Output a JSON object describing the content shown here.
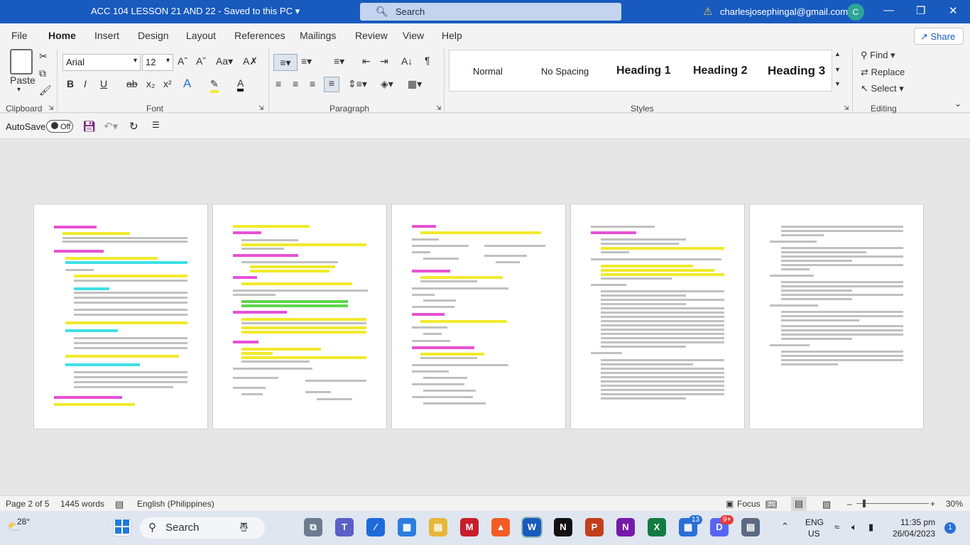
{
  "titlebar": {
    "doc_title": "ACC 104 LESSON 21 AND 22  -  Saved to this PC  ▾",
    "search_placeholder": "Search",
    "email": "charlesjosephingal@gmail.com",
    "avatar_initial": "C",
    "minimize": "—",
    "restore": "❐",
    "close": "✕"
  },
  "menu": {
    "tabs": [
      "File",
      "Home",
      "Insert",
      "Design",
      "Layout",
      "References",
      "Mailings",
      "Review",
      "View",
      "Help"
    ],
    "active": "Home",
    "share_label": "Share"
  },
  "ribbon": {
    "clipboard": {
      "label": "Clipboard",
      "paste_label": "Paste"
    },
    "font": {
      "label": "Font",
      "family": "Arial",
      "size": "12"
    },
    "paragraph": {
      "label": "Paragraph"
    },
    "styles": {
      "label": "Styles",
      "items": [
        "Normal",
        "No Spacing",
        "Heading 1",
        "Heading 2",
        "Heading 3"
      ]
    },
    "editing": {
      "label": "Editing",
      "find": "Find",
      "replace": "Replace",
      "select": "Select"
    }
  },
  "qat": {
    "autosave_label": "AutoSave",
    "autosave_state": "Off"
  },
  "status": {
    "page": "Page 2 of 5",
    "words": "1445 words",
    "language": "English (Philippines)",
    "focus": "Focus",
    "zoom": "30%"
  },
  "taskbar": {
    "weather_temp": "28°",
    "search_label": "Search",
    "language": "ENG",
    "region": "US",
    "time": "11:35 pm",
    "date": "26/04/2023",
    "notification_count": "1",
    "badge_13": "13",
    "badge_9": "9+"
  },
  "colors": {
    "brand": "#185abd",
    "highlight_yellow": "#f2ea2c",
    "highlight_magenta": "#e652d4",
    "highlight_cyan": "#3ee0e6",
    "highlight_green": "#5fd54b"
  }
}
